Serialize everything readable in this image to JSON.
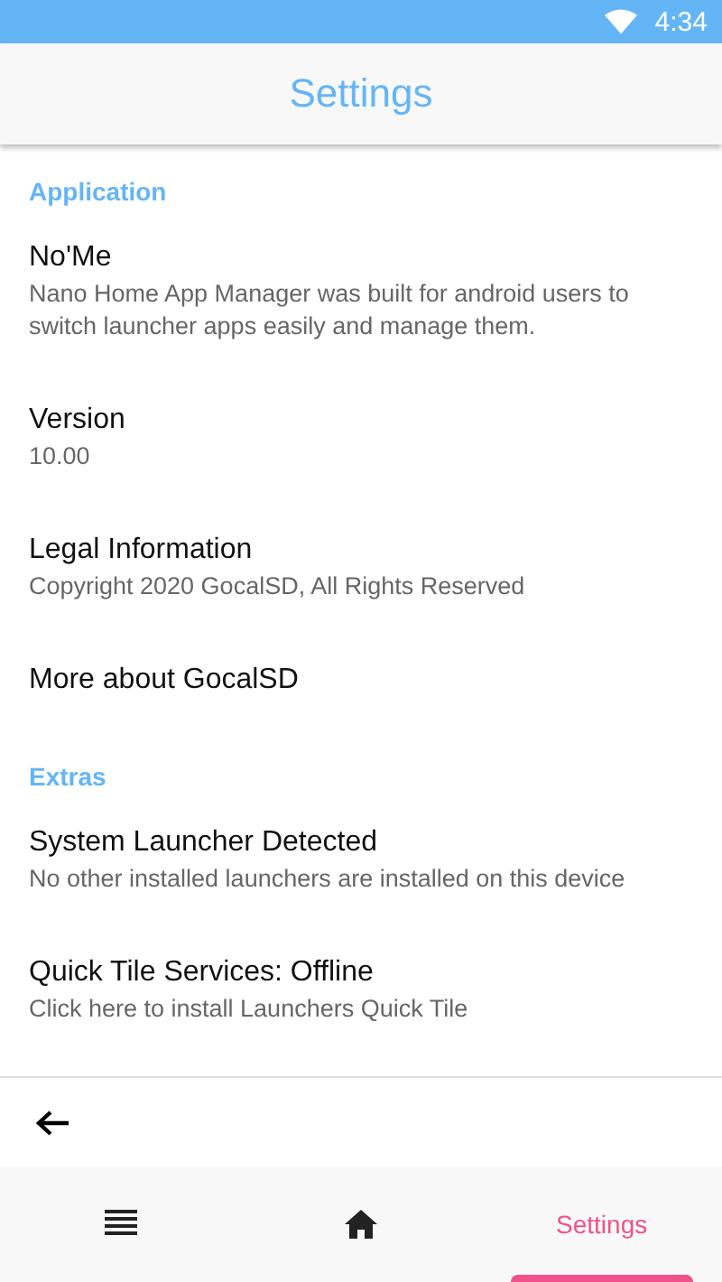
{
  "status_bar": {
    "time": "4:34"
  },
  "app_bar": {
    "title": "Settings"
  },
  "sections": [
    {
      "header": "Application",
      "items": [
        {
          "title": "No'Me",
          "subtitle": "Nano Home App Manager was built for android users to switch launcher apps easily and manage them."
        },
        {
          "title": "Version",
          "subtitle": "10.00"
        },
        {
          "title": "Legal Information",
          "subtitle": "Copyright 2020 GocalSD, All Rights Reserved"
        },
        {
          "title": "More about GocalSD"
        }
      ]
    },
    {
      "header": "Extras",
      "items": [
        {
          "title": "System Launcher Detected",
          "subtitle": "No other installed launchers are installed on this device"
        },
        {
          "title": "Quick Tile Services: Offline",
          "subtitle": "Click here to install Launchers Quick Tile"
        }
      ]
    }
  ],
  "bottom_nav": [
    {
      "kind": "menu",
      "selected": false
    },
    {
      "kind": "home",
      "selected": false
    },
    {
      "kind": "label",
      "label": "Settings",
      "selected": true
    }
  ]
}
